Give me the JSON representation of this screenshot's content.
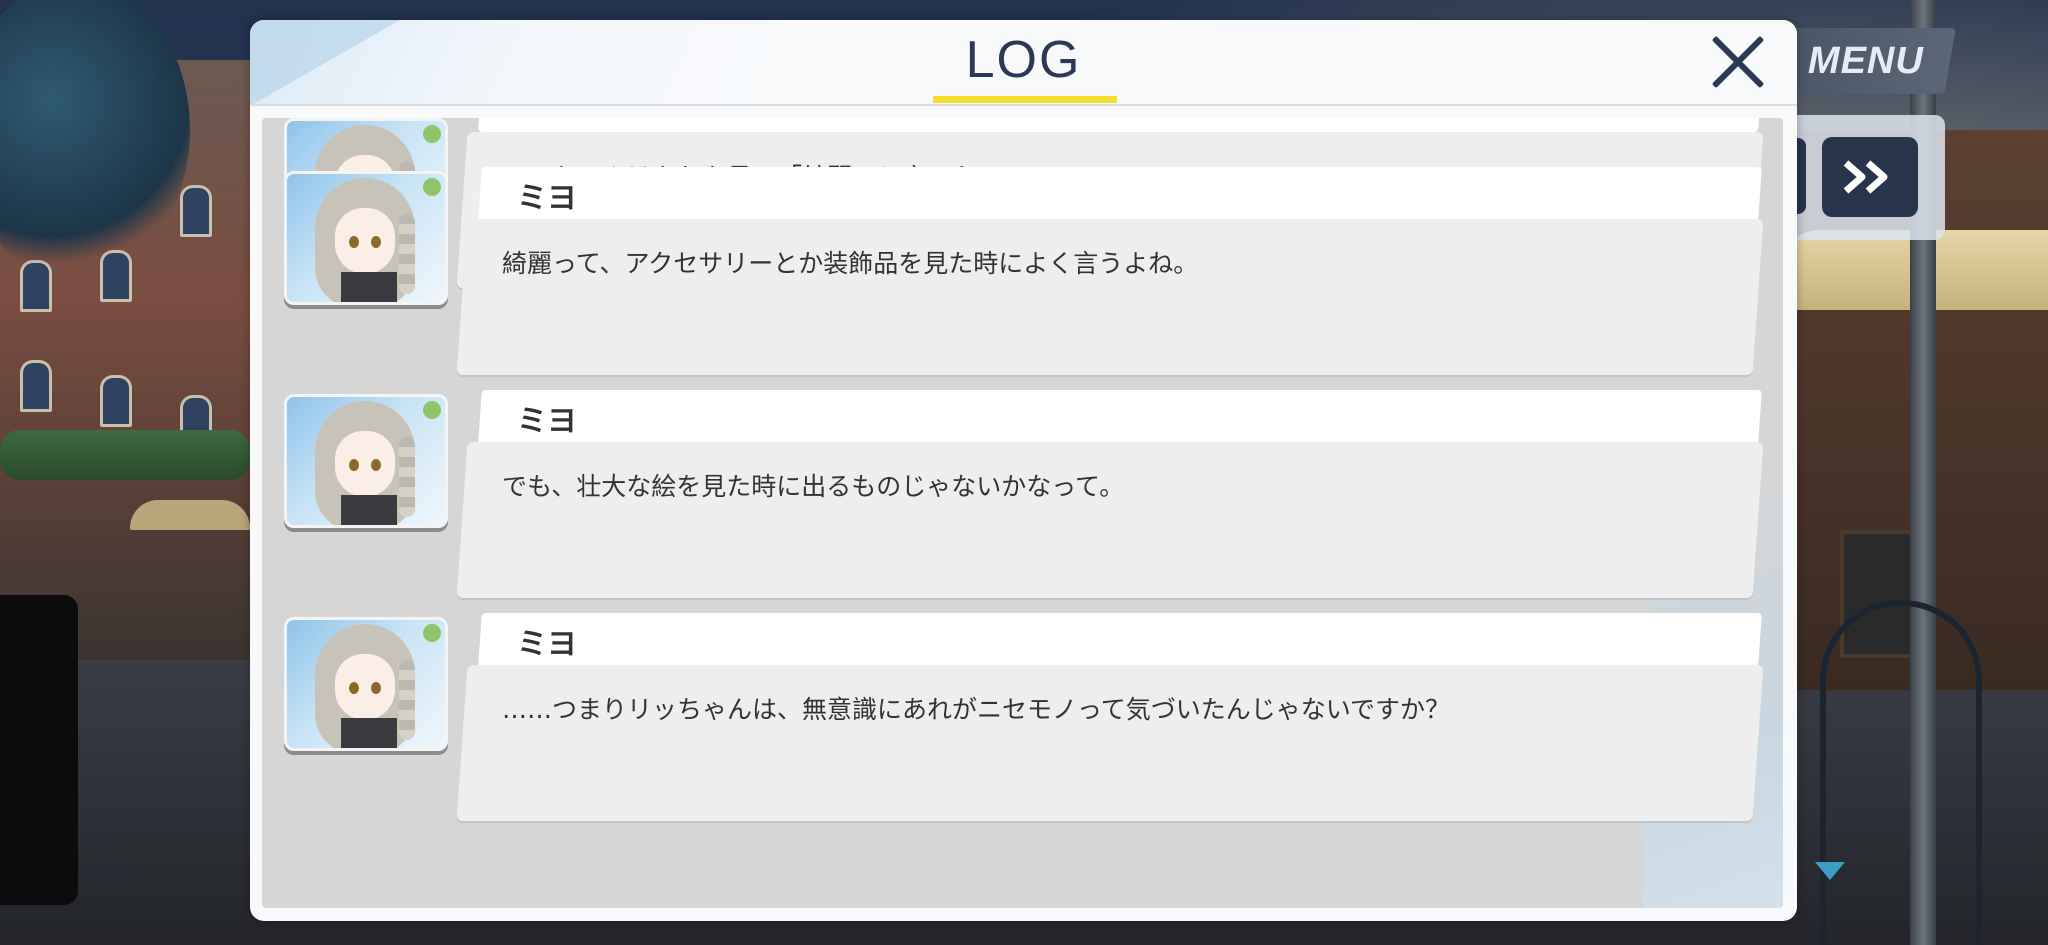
{
  "hud": {
    "menu_label": "MENU"
  },
  "log": {
    "title": "LOG",
    "entries": [
      {
        "speaker": "",
        "text": "リッちゃんはあれを見て「綺麗」と言った。"
      },
      {
        "speaker": "ミヨ",
        "text": "綺麗って、アクセサリーとか装飾品を見た時によく言うよね。"
      },
      {
        "speaker": "ミヨ",
        "text": "でも、壮大な絵を見た時に出るものじゃないかなって。"
      },
      {
        "speaker": "ミヨ",
        "text": "……つまりリッちゃんは、無意識にあれがニセモノって気づいたんじゃないですか？"
      }
    ]
  },
  "colors": {
    "title_underline": "#f4de2c",
    "title_text": "#2a3a55",
    "skip_button": "#26344c",
    "scroll_indicator": "#3a9ec4"
  },
  "icons": {
    "close": "close-icon",
    "skip": "fast-forward-icon",
    "scroll": "scroll-down-arrow-icon"
  }
}
